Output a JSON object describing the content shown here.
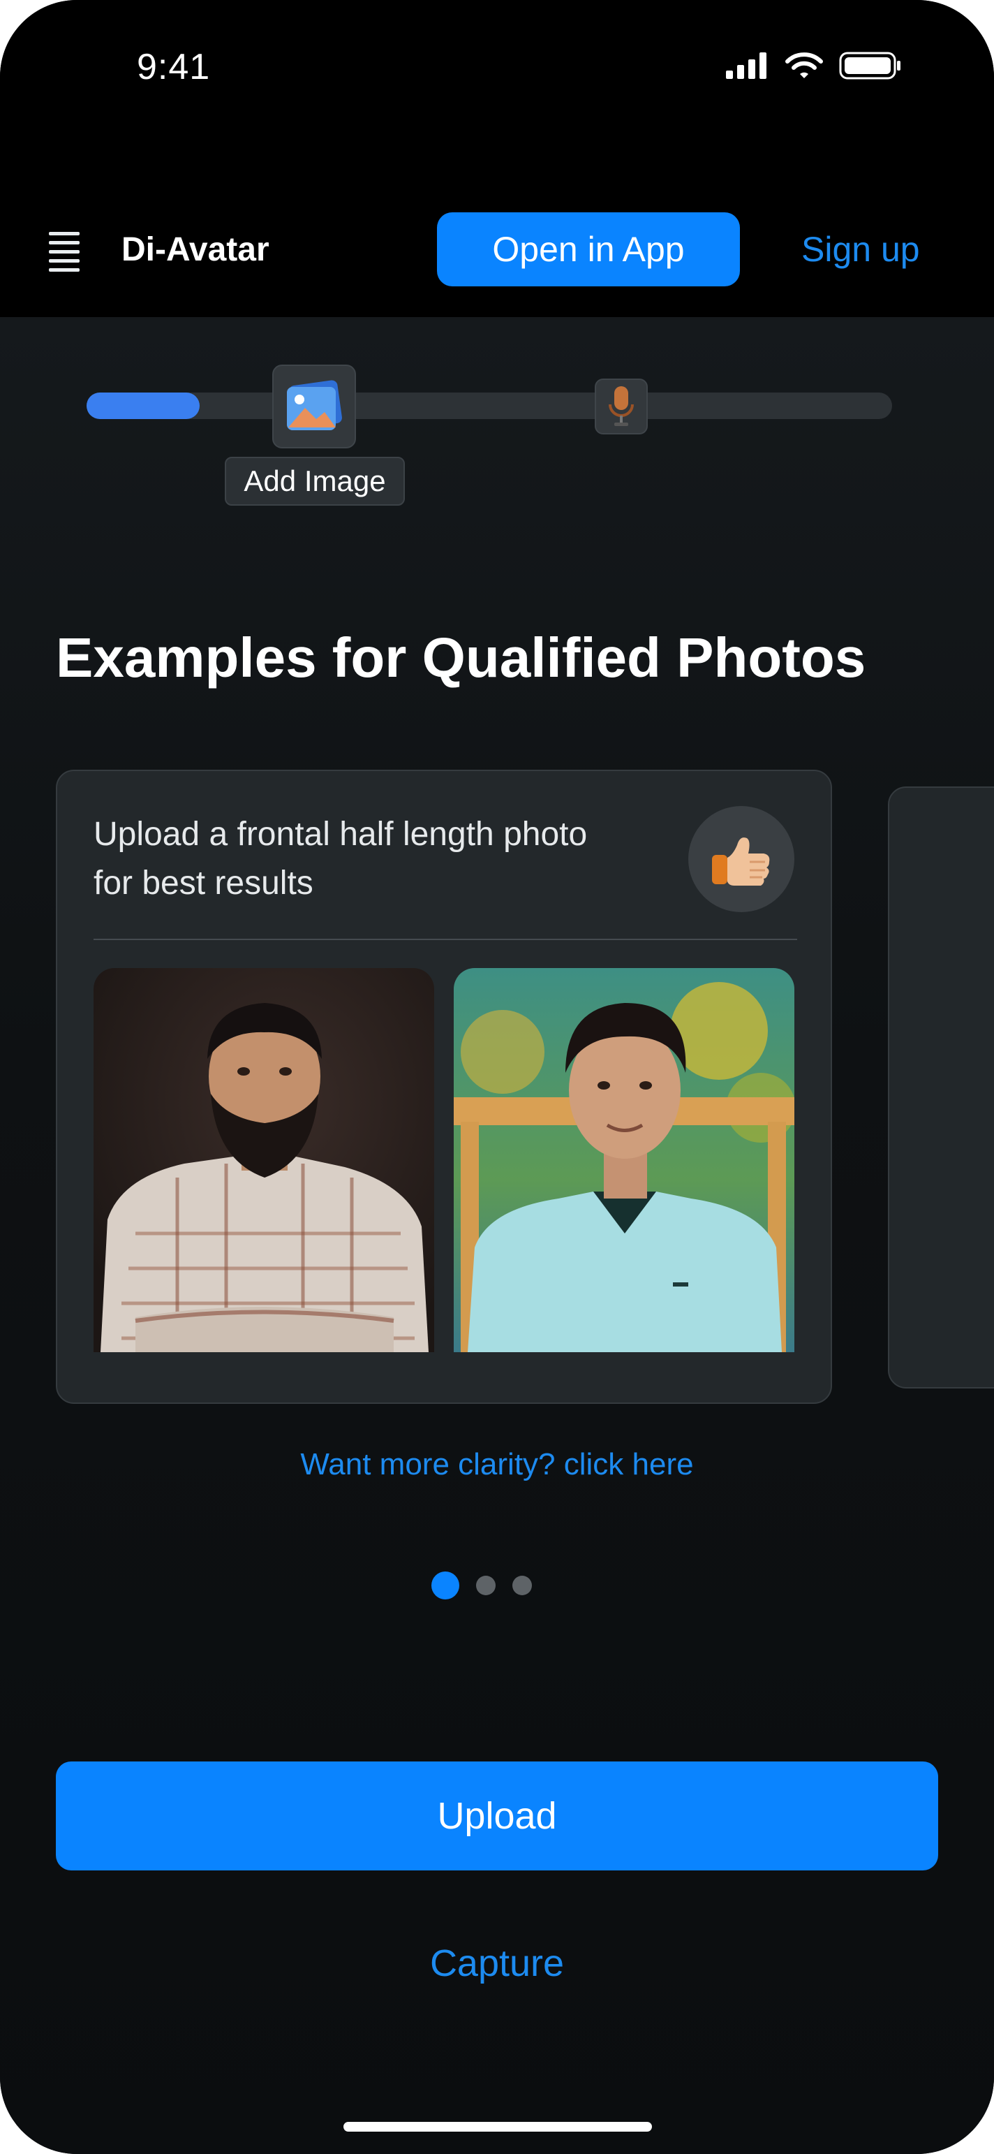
{
  "status_bar": {
    "time": "9:41",
    "icons": [
      "signal-icon",
      "wifi-icon",
      "battery-icon"
    ]
  },
  "header": {
    "menu_icon": "hamburger-icon",
    "brand": "Di-Avatar",
    "open_in_app": "Open  in App",
    "sign_up": "Sign up"
  },
  "progress": {
    "fraction": 0.14,
    "steps": [
      {
        "name": "add-image",
        "icon": "image-icon",
        "label": "Add Image"
      },
      {
        "name": "record-voice",
        "icon": "microphone-icon"
      }
    ]
  },
  "main": {
    "heading": "Examples for Qualified Photos",
    "card": {
      "text": "Upload a frontal half length photo for best results",
      "badge_icon": "thumbs-up-icon"
    },
    "clarity_link": "Want more clarity? click here",
    "carousel": {
      "count": 3,
      "active": 0
    }
  },
  "actions": {
    "upload": "Upload",
    "capture": "Capture"
  },
  "colors": {
    "accent": "#0a84ff",
    "link": "#1d8bf0",
    "background": "#0b0d0f",
    "card": "#23282b"
  }
}
